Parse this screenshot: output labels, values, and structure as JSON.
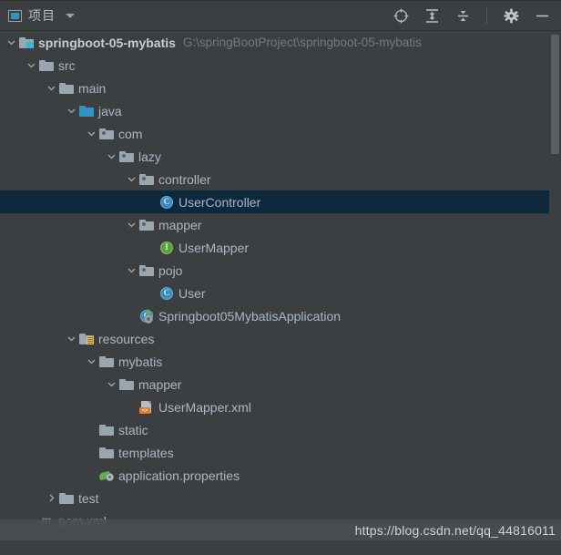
{
  "toolbar": {
    "project_icon": "project-window-icon",
    "title": "项目",
    "dropdown_icon": "chevron-down-icon",
    "buttons": [
      {
        "name": "locate-in-tree",
        "icon": "crosshair-target-icon"
      },
      {
        "name": "expand-all",
        "icon": "expand-all-icon"
      },
      {
        "name": "collapse-all",
        "icon": "collapse-all-icon"
      },
      {
        "name": "settings",
        "icon": "gear-icon"
      },
      {
        "name": "hide-tool-window",
        "icon": "minimize-icon"
      }
    ]
  },
  "tree": {
    "rows": [
      {
        "depth": 0,
        "twisty": "expanded",
        "icon": "module-folder-icon",
        "label": "springboot-05-mybatis",
        "bold": true,
        "path": "G:\\springBootProject\\springboot-05-mybatis",
        "selected": false
      },
      {
        "depth": 1,
        "twisty": "expanded",
        "icon": "folder-icon",
        "label": "src",
        "bold": false,
        "path": "",
        "selected": false
      },
      {
        "depth": 2,
        "twisty": "expanded",
        "icon": "folder-icon",
        "label": "main",
        "bold": false,
        "path": "",
        "selected": false
      },
      {
        "depth": 3,
        "twisty": "expanded",
        "icon": "sources-root-folder-icon",
        "label": "java",
        "bold": false,
        "path": "",
        "selected": false
      },
      {
        "depth": 4,
        "twisty": "expanded",
        "icon": "package-icon",
        "label": "com",
        "bold": false,
        "path": "",
        "selected": false
      },
      {
        "depth": 5,
        "twisty": "expanded",
        "icon": "package-icon",
        "label": "lazy",
        "bold": false,
        "path": "",
        "selected": false
      },
      {
        "depth": 6,
        "twisty": "expanded",
        "icon": "package-icon",
        "label": "controller",
        "bold": false,
        "path": "",
        "selected": false
      },
      {
        "depth": 7,
        "twisty": "none",
        "icon": "java-class-icon",
        "label": "UserController",
        "bold": false,
        "path": "",
        "selected": true
      },
      {
        "depth": 6,
        "twisty": "expanded",
        "icon": "package-icon",
        "label": "mapper",
        "bold": false,
        "path": "",
        "selected": false
      },
      {
        "depth": 7,
        "twisty": "none",
        "icon": "java-interface-icon",
        "label": "UserMapper",
        "bold": false,
        "path": "",
        "selected": false
      },
      {
        "depth": 6,
        "twisty": "expanded",
        "icon": "package-icon",
        "label": "pojo",
        "bold": false,
        "path": "",
        "selected": false
      },
      {
        "depth": 7,
        "twisty": "none",
        "icon": "java-class-icon",
        "label": "User",
        "bold": false,
        "path": "",
        "selected": false
      },
      {
        "depth": 6,
        "twisty": "none",
        "icon": "spring-boot-class-icon",
        "label": "Springboot05MybatisApplication",
        "bold": false,
        "path": "",
        "selected": false
      },
      {
        "depth": 3,
        "twisty": "expanded",
        "icon": "resources-folder-icon",
        "label": "resources",
        "bold": false,
        "path": "",
        "selected": false
      },
      {
        "depth": 4,
        "twisty": "expanded",
        "icon": "folder-icon",
        "label": "mybatis",
        "bold": false,
        "path": "",
        "selected": false
      },
      {
        "depth": 5,
        "twisty": "expanded",
        "icon": "folder-icon",
        "label": "mapper",
        "bold": false,
        "path": "",
        "selected": false
      },
      {
        "depth": 6,
        "twisty": "none",
        "icon": "xml-file-icon",
        "label": "UserMapper.xml",
        "bold": false,
        "path": "",
        "selected": false
      },
      {
        "depth": 4,
        "twisty": "none",
        "icon": "folder-icon",
        "label": "static",
        "bold": false,
        "path": "",
        "selected": false
      },
      {
        "depth": 4,
        "twisty": "none",
        "icon": "folder-icon",
        "label": "templates",
        "bold": false,
        "path": "",
        "selected": false
      },
      {
        "depth": 4,
        "twisty": "none",
        "icon": "spring-properties-icon",
        "label": "application.properties",
        "bold": false,
        "path": "",
        "selected": false
      },
      {
        "depth": 2,
        "twisty": "collapsed",
        "icon": "folder-icon",
        "label": "test",
        "bold": false,
        "path": "",
        "selected": false
      },
      {
        "depth": 1,
        "twisty": "none",
        "icon": "maven-pom-icon",
        "label": "pom.xml",
        "bold": false,
        "path": "",
        "selected": false
      }
    ]
  },
  "scrollbar": {
    "name": "vertical-scrollbar"
  },
  "watermark": {
    "text": "https://blog.csdn.net/qq_44816011"
  }
}
